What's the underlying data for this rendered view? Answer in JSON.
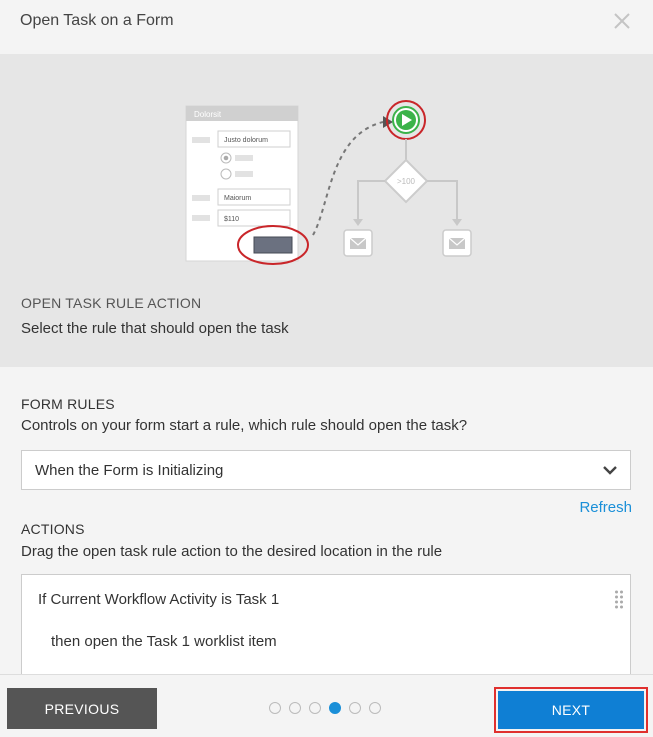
{
  "dialog": {
    "title": "Open Task on a Form"
  },
  "illustration": {
    "form_title": "Dolorsit",
    "field1_value": "Justo dolorum",
    "field2_value": "Maiorum",
    "field3_value": "$110",
    "decision_label": ">100"
  },
  "hero": {
    "heading": "OPEN TASK RULE ACTION",
    "subheading": "Select the rule that should open the task"
  },
  "form_rules": {
    "label": "FORM RULES",
    "description": "Controls on your form start a rule, which rule should open the task?",
    "selected": "When the Form is Initializing",
    "refresh_label": "Refresh"
  },
  "actions": {
    "label": "ACTIONS",
    "description": "Drag the open task rule action to the desired location in the rule",
    "condition": "If Current Workflow Activity is Task 1",
    "action": "then open the Task 1 worklist item"
  },
  "footer": {
    "previous_label": "PREVIOUS",
    "next_label": "NEXT",
    "steps_total": 6,
    "current_step": 4
  },
  "colors": {
    "accent": "#0f7fd4",
    "link": "#1a8fd8",
    "highlight": "#e0302e",
    "start_node": "#3cb34a"
  }
}
